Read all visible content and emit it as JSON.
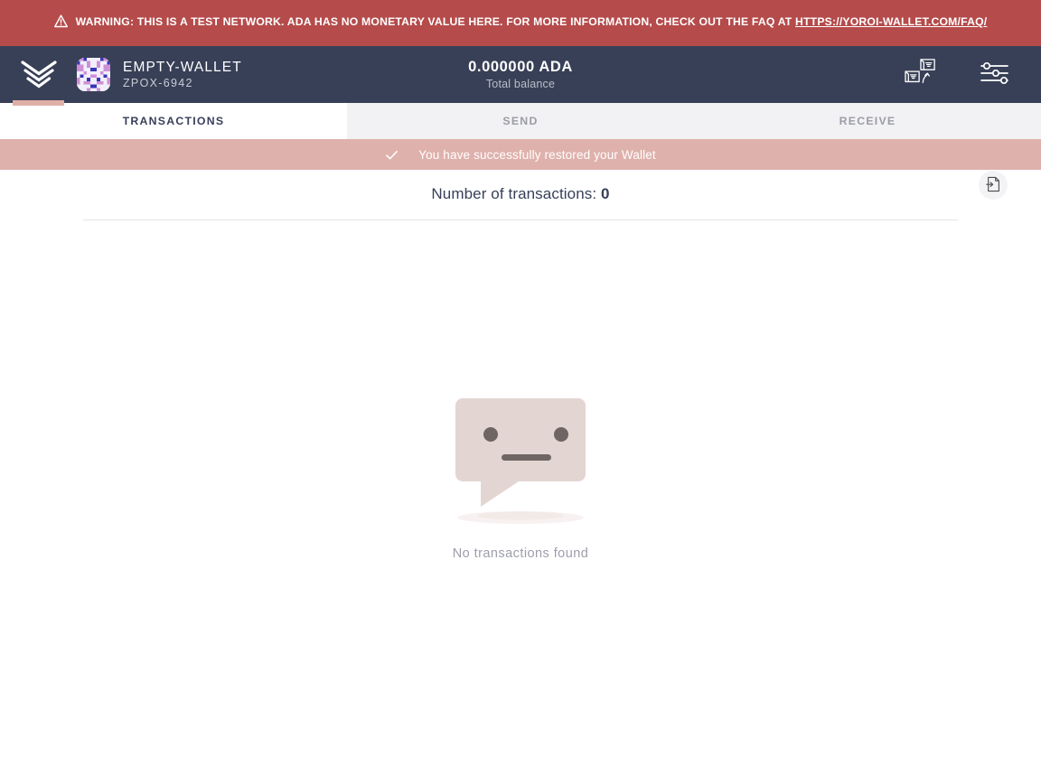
{
  "warning_banner": {
    "icon": "warning-triangle-icon",
    "text_before_link": "WARNING: THIS IS A TEST NETWORK. ADA HAS NO MONETARY VALUE HERE. FOR MORE INFORMATION, CHECK OUT THE FAQ AT ",
    "link_text": "HTTPS://YOROI-WALLET.COM/FAQ/",
    "background_color": "#b54b4b",
    "text_color": "#ffffff"
  },
  "header": {
    "logo_icon": "yoroi-logo-icon",
    "wallet": {
      "avatar_icon": "wallet-identicon-avatar",
      "name": "EMPTY-WALLET",
      "plate_id": "ZPOX-6942"
    },
    "balance": {
      "amount": "0.000000 ADA",
      "label": "Total balance"
    },
    "actions": [
      {
        "name": "switch-wallet-button",
        "icon": "switch-wallet-icon"
      },
      {
        "name": "settings-button",
        "icon": "sliders-settings-icon"
      }
    ],
    "background_color": "#384057",
    "accent_underline_color": "#dfafa7"
  },
  "tabs": [
    {
      "label": "Transactions",
      "active": true
    },
    {
      "label": "Send",
      "active": false
    },
    {
      "label": "Receive",
      "active": false
    }
  ],
  "notification": {
    "icon": "check-icon",
    "message": "You have successfully restored your Wallet",
    "background_color": "#dfb1ac",
    "text_color": "#ffffff"
  },
  "transactions_panel": {
    "count_label": "Number of transactions:",
    "count_value": "0",
    "export_button": {
      "name": "export-transactions-button",
      "icon": "export-file-icon"
    },
    "empty_state": {
      "illustration": "no-transactions-speech-bubble-face",
      "message": "No transactions found"
    }
  }
}
